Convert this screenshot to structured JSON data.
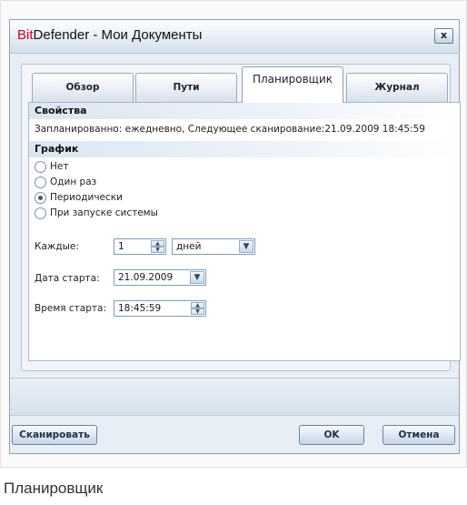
{
  "window": {
    "title_brand": "Bit",
    "title_rest": "Defender - Мои Документы",
    "close_label": "x"
  },
  "tabs": [
    {
      "label": "Обзор",
      "active": false
    },
    {
      "label": "Пути",
      "active": false
    },
    {
      "label": "Планировщик",
      "active": true
    },
    {
      "label": "Журнал",
      "active": false
    }
  ],
  "properties": {
    "heading": "Свойства",
    "summary": "Запланированно: ежедневно, Следующее сканирование:21.09.2009 18:45:59"
  },
  "schedule": {
    "heading": "График",
    "options": [
      {
        "label": "Нет",
        "checked": false
      },
      {
        "label": "Один раз",
        "checked": false
      },
      {
        "label": "Периодически",
        "checked": true
      },
      {
        "label": "При запуске системы",
        "checked": false
      }
    ],
    "every_label": "Каждые:",
    "every_value": "1",
    "every_unit": "дней",
    "start_date_label": "Дата старта:",
    "start_date_value": "21.09.2009",
    "start_time_label": "Время старта:",
    "start_time_value": "18:45:59"
  },
  "buttons": {
    "scan": "Сканировать",
    "ok": "OK",
    "cancel": "Отмена"
  },
  "caption": "Планировщик",
  "icons": {
    "spin": "spin-updown-icon",
    "dropdown": "chevron-down-icon"
  },
  "colors": {
    "brand_red": "#d0021b",
    "section_bg": "#dbe6f3",
    "border": "#7f9db9"
  }
}
